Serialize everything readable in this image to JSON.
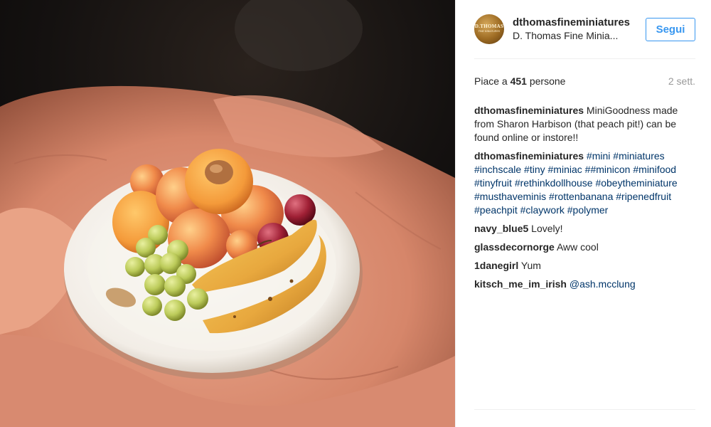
{
  "photo": {
    "description_icon": "miniature-fruit-plate-photo"
  },
  "header": {
    "avatar_text_line1": "D.THOMAS",
    "avatar_text_line2": "FINE MINIATURES",
    "username": "dthomasfineminiatures",
    "full_name": "D. Thomas Fine Minia...",
    "follow_label": "Segui"
  },
  "stats": {
    "likes_prefix": "Piace a ",
    "likes_count": "451",
    "likes_suffix": " persone",
    "time": "2 sett."
  },
  "comments": [
    {
      "user": "dthomasfineminiatures",
      "text": "MiniGoodness made from Sharon Harbison (that peach pit!) can be found online or instore!!"
    },
    {
      "user": "dthomasfineminiatures",
      "hashtags": [
        "#mini",
        "#miniatures",
        "#inchscale",
        "#tiny",
        "#miniac",
        "##minicon",
        "#minifood",
        "#tinyfruit",
        "#rethinkdollhouse",
        "#obeytheminiature",
        "#musthaveminis",
        "#rottenbanana",
        "#ripenedfruit",
        "#peachpit",
        "#claywork",
        "#polymer"
      ]
    },
    {
      "user": "navy_blue5",
      "text": "Lovely!"
    },
    {
      "user": "glassdecornorge",
      "text": "Aww cool"
    },
    {
      "user": "1danegirl",
      "text": "Yum"
    },
    {
      "user": "kitsch_me_im_irish",
      "mention": "@ash.mcclung"
    }
  ],
  "colors": {
    "link_blue": "#3897f0",
    "hashtag_blue": "#003569",
    "muted_gray": "#999999",
    "text": "#262626"
  }
}
